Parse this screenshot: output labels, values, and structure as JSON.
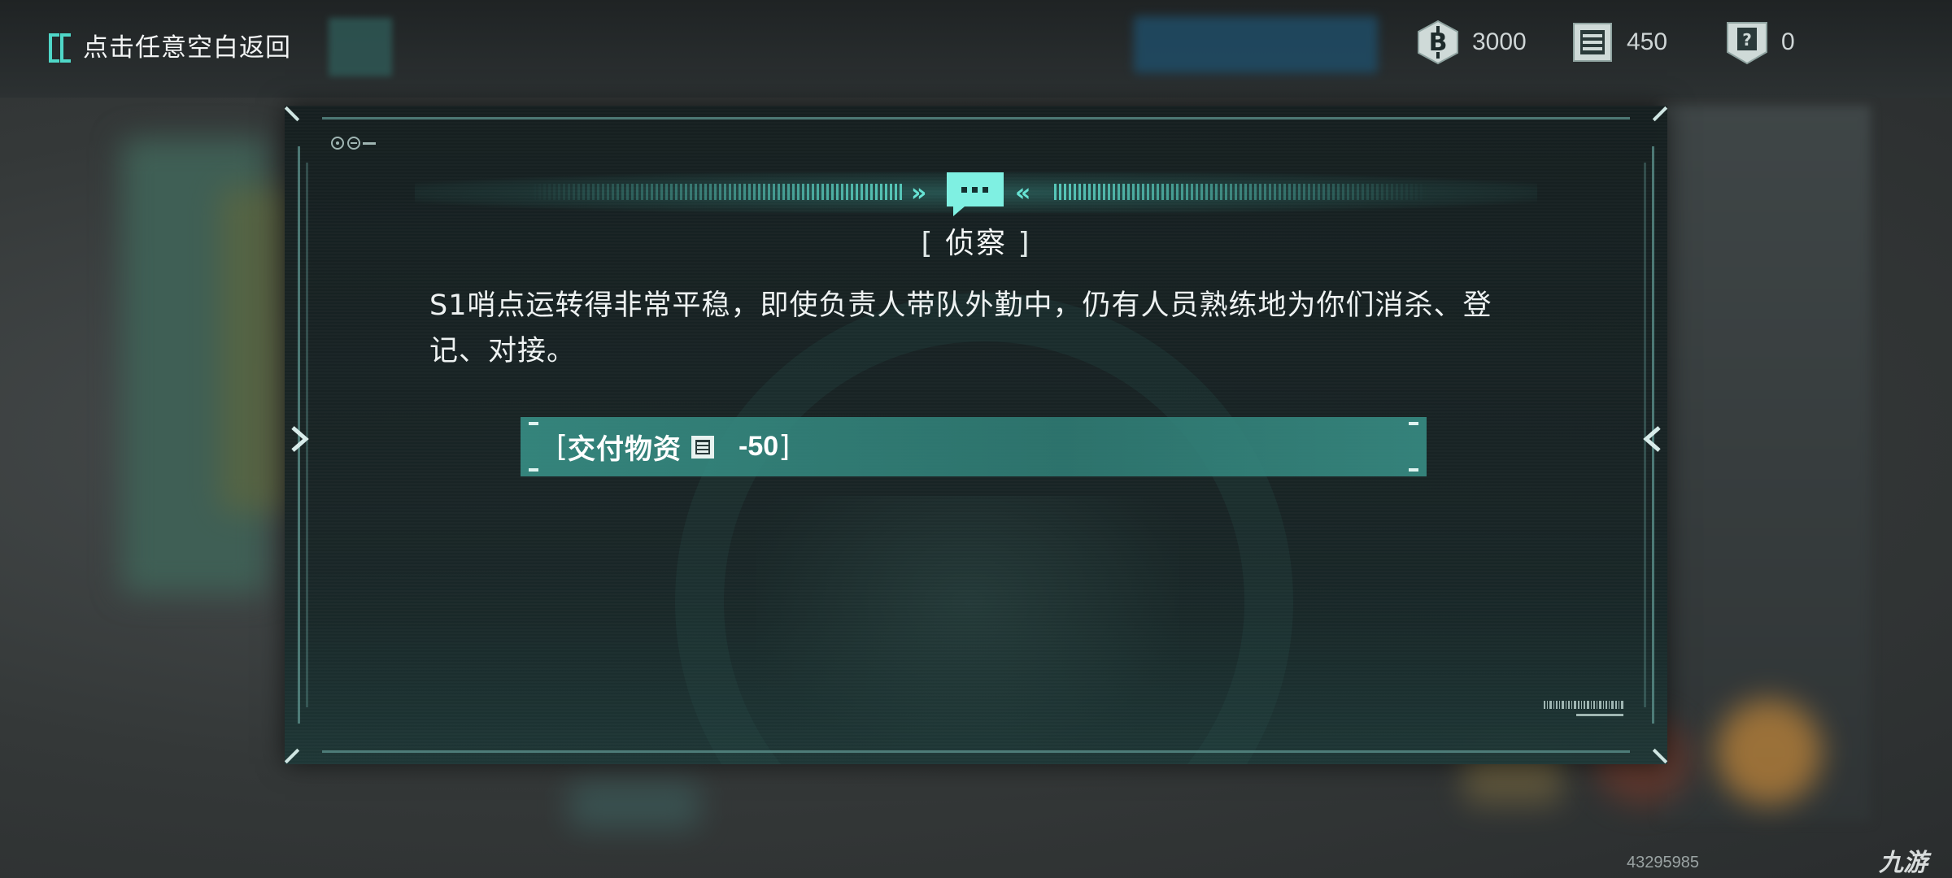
{
  "top_bar": {
    "back_label": "点击任意空白返回"
  },
  "currencies": [
    {
      "icon": "coin-b-icon",
      "value": "3000"
    },
    {
      "icon": "supply-crate-icon",
      "value": "450"
    },
    {
      "icon": "mystery-card-icon",
      "value": "0"
    }
  ],
  "dialog": {
    "title_open": "[",
    "title": "侦察",
    "title_close": "]",
    "body": "S1哨点运转得非常平稳，即使负责人带队外勤中，仍有人员熟练地为你们消杀、登记、对接。",
    "option": {
      "bracket_open": "[",
      "label": "交付物资",
      "cost": "-50",
      "bracket_close": "]",
      "cost_icon": "supply-crate-icon"
    }
  },
  "watermark": {
    "id": "43295985",
    "logo": "九游"
  },
  "colors": {
    "accent": "#4fd7c8",
    "option_bg": "#3a9488",
    "dialog_bg": "#162223"
  }
}
